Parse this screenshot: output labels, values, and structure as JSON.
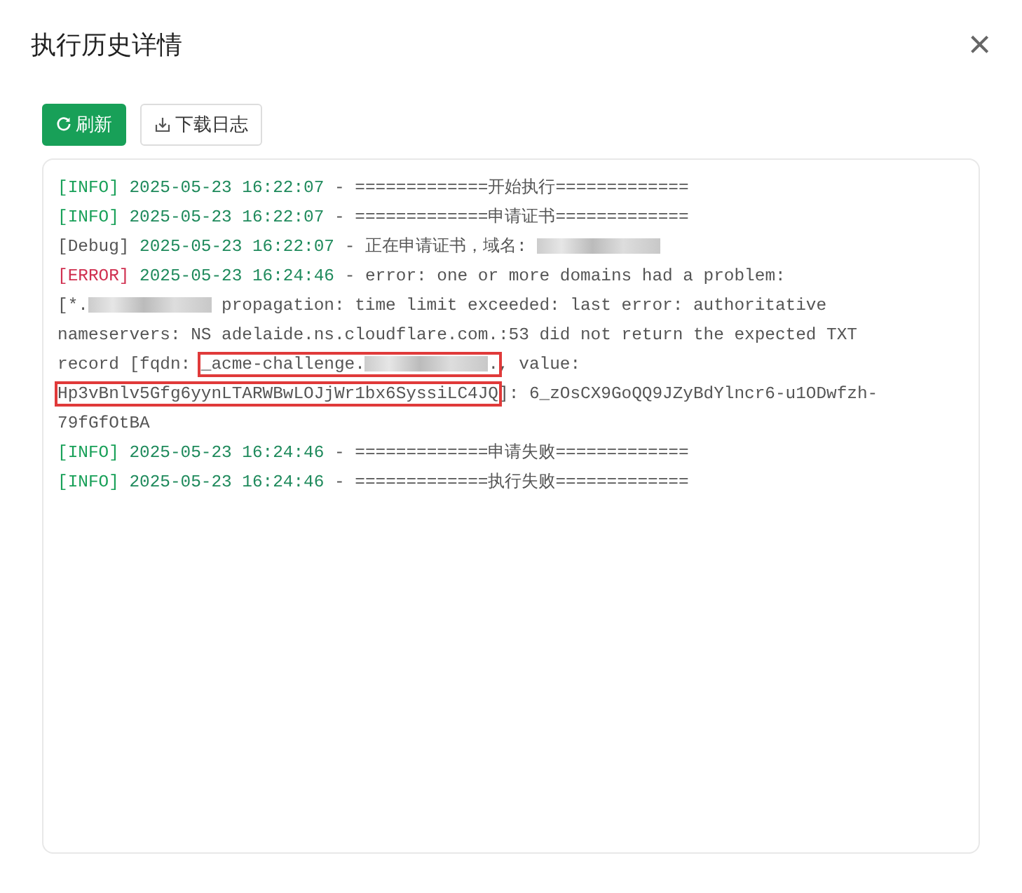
{
  "dialog": {
    "title": "执行历史详情",
    "close": "×"
  },
  "toolbar": [
    {
      "kind": "primary",
      "label": "刷新"
    },
    {
      "kind": "secondary",
      "label": "下载日志"
    }
  ],
  "log": [
    {
      "kind": "info",
      "tag": "[INFO]",
      "time": "2025-05-23 16:22:07",
      "lines": [
        [
          {
            "kind": "text",
            "text": "- =============开始执行============="
          }
        ]
      ]
    },
    {
      "kind": "info",
      "tag": "[INFO]",
      "time": "2025-05-23 16:22:07",
      "lines": [
        [
          {
            "kind": "text",
            "text": "- =============申请证书============="
          }
        ]
      ]
    },
    {
      "kind": "debug",
      "tag": "[Debug]",
      "time": "2025-05-23 16:22:07",
      "lines": [
        [
          {
            "kind": "text",
            "text": "- 正在申请证书，域名: "
          },
          {
            "kind": "redacted"
          }
        ]
      ]
    },
    {
      "kind": "error",
      "tag": "[ERROR]",
      "time": "2025-05-23 16:24:46",
      "lines": [
        [
          {
            "kind": "text",
            "text": "- error: one or more domains had a problem:"
          }
        ],
        [
          {
            "kind": "text",
            "text": "[*."
          },
          {
            "kind": "redacted"
          },
          {
            "kind": "text",
            "text": " propagation: time limit exceeded: last error: authoritative"
          }
        ],
        [
          {
            "kind": "text",
            "text": "nameservers: NS adelaide.ns.cloudflare.com.:53 did not return the expected TXT"
          }
        ],
        [
          {
            "kind": "text",
            "text": "record [fqdn: "
          },
          {
            "kind": "highlight",
            "parts": [
              {
                "kind": "text",
                "text": "_acme-challenge."
              },
              {
                "kind": "redacted"
              },
              {
                "kind": "text",
                "text": "."
              }
            ]
          },
          {
            "kind": "text",
            "text": ", value:"
          }
        ],
        [
          {
            "kind": "highlight",
            "parts": [
              {
                "kind": "text",
                "text": "Hp3vBnlv5Gfg6yynLTARWBwLOJjWr1bx6SyssiLC4JQ"
              }
            ]
          },
          {
            "kind": "text",
            "text": "]: 6_zOsCX9GoQQ9JZyBdYlncr6-u1ODwfzh-"
          }
        ],
        [
          {
            "kind": "text",
            "text": "79fGfOtBA"
          }
        ]
      ]
    },
    {
      "kind": "info",
      "tag": "[INFO]",
      "time": "2025-05-23 16:24:46",
      "lines": [
        [
          {
            "kind": "text",
            "text": "- =============申请失败============="
          }
        ]
      ]
    },
    {
      "kind": "info",
      "tag": "[INFO]",
      "time": "2025-05-23 16:24:46",
      "lines": [
        [
          {
            "kind": "text",
            "text": "- =============执行失败============="
          }
        ]
      ]
    }
  ]
}
